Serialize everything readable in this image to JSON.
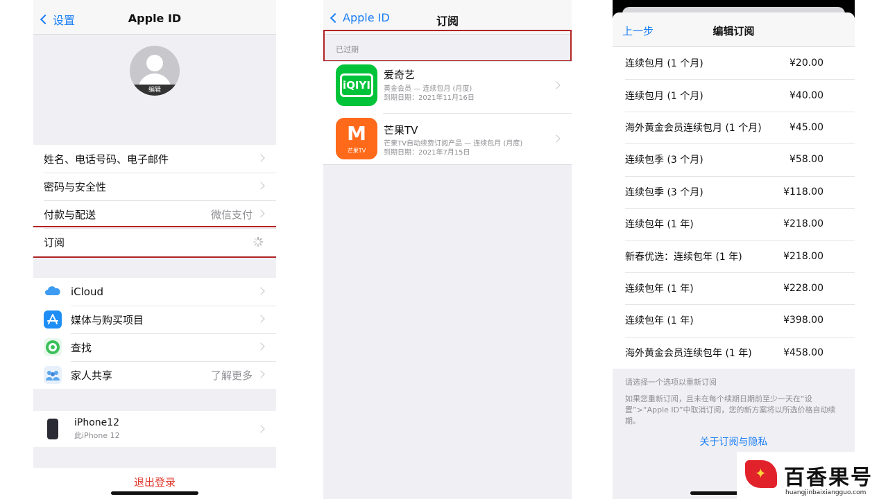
{
  "panel_apple_id": {
    "back_label": "设置",
    "title": "Apple ID",
    "avatar_edit": "编辑",
    "account_rows": [
      {
        "label": "姓名、电话号码、电子邮件",
        "value": ""
      },
      {
        "label": "密码与安全性",
        "value": ""
      },
      {
        "label": "付款与配送",
        "value": "微信支付"
      },
      {
        "label": "订阅",
        "value": ""
      }
    ],
    "service_rows": [
      {
        "label": "iCloud",
        "value": "",
        "icon": "icloud-icon"
      },
      {
        "label": "媒体与购买项目",
        "value": "",
        "icon": "app-store-icon"
      },
      {
        "label": "查找",
        "value": "",
        "icon": "find-my-icon"
      },
      {
        "label": "家人共享",
        "value": "了解更多",
        "icon": "family-sharing-icon"
      }
    ],
    "device": {
      "name": "iPhone12",
      "subtitle": "此iPhone 12"
    },
    "logout_label": "退出登录"
  },
  "panel_subscriptions": {
    "back_label": "Apple ID",
    "title": "订阅",
    "section_header": "已过期",
    "items": [
      {
        "name": "爱奇艺",
        "logo_text": "iQIYI",
        "plan": "黄金会员 — 连续包月 (月度)",
        "expiry": "到期日期：2021年11月16日"
      },
      {
        "name": "芒果TV",
        "logo_text": "M",
        "logo_caption": "芒果TV",
        "plan": "芒果TV自动续费订阅产品 — 连续包月 (月度)",
        "expiry": "到期日期：2021年7月15日"
      }
    ]
  },
  "panel_edit": {
    "prev_label": "上一步",
    "title": "编辑订阅",
    "plans": [
      {
        "name": "连续包月 (1 个月)",
        "price": "¥20.00"
      },
      {
        "name": "连续包月 (1 个月)",
        "price": "¥40.00"
      },
      {
        "name": "海外黄金会员连续包月 (1 个月)",
        "price": "¥45.00"
      },
      {
        "name": "连续包季 (3 个月)",
        "price": "¥58.00"
      },
      {
        "name": "连续包季 (3 个月)",
        "price": "¥118.00"
      },
      {
        "name": "连续包年 (1 年)",
        "price": "¥218.00"
      },
      {
        "name": "新春优选：连续包年 (1 年)",
        "price": "¥218.00"
      },
      {
        "name": "连续包年 (1 年)",
        "price": "¥228.00"
      },
      {
        "name": "连续包年 (1 年)",
        "price": "¥398.00"
      },
      {
        "name": "海外黄金会员连续包年 (1 年)",
        "price": "¥458.00"
      }
    ],
    "hint": "请选择一个选项以重新订阅",
    "note": "如果您重新订阅，且未在每个续期日期前至少一天在“设置”>“Apple ID”中取消订阅，您的新方案将以所选价格自动续期。",
    "privacy_link": "关于订阅与隐私"
  },
  "watermark": {
    "text": "百香果号",
    "url": "huangjinbaixiangguo.com"
  },
  "colors": {
    "accent": "#1a7ef5",
    "highlight": "#b22424",
    "destructive": "#e0362b"
  }
}
